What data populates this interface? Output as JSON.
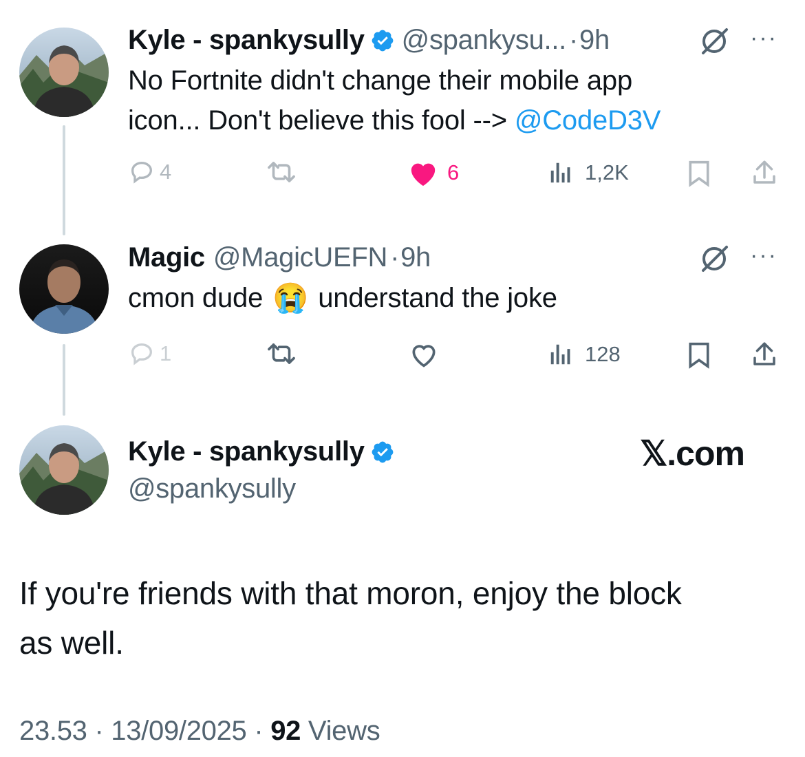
{
  "tweet1": {
    "name": "Kyle - spankysully",
    "handle": "@spankysu...",
    "sep": "·",
    "time": "9h",
    "text_line1": "No Fortnite didn't change their mobile app",
    "text_line2_prefix": "icon... Don't believe this fool -->",
    "mention": "@CodeD3V",
    "replies": "4",
    "likes": "6",
    "views": "1,2K",
    "more": "···"
  },
  "tweet2": {
    "name": "Magic",
    "handle": "@MagicUEFN",
    "sep": "·",
    "time": "9h",
    "text_before": "cmon dude",
    "emoji": "😭",
    "text_after": "understand the joke",
    "replies": "1",
    "views": "128",
    "more": "···"
  },
  "tweet3": {
    "name": "Kyle - spankysully",
    "handle": "@spankysully",
    "brand": "𝕏.com",
    "text_line1": "If you're friends with that moron, enjoy the block",
    "text_line2": "as well.",
    "time": "23.53",
    "sep1": "·",
    "date": "13/09/2025",
    "sep2": "·",
    "views_count": "92",
    "views_label": "Views"
  },
  "colors": {
    "accent": "#1d9bf0",
    "like": "#f91880",
    "text": "#0f1419",
    "secondary": "#536471",
    "thread_line": "#cfd9de"
  },
  "icons": [
    "verified-badge-icon",
    "grok-icon",
    "more-icon",
    "reply-icon",
    "retweet-icon",
    "like-icon",
    "views-icon",
    "bookmark-icon",
    "share-icon"
  ]
}
